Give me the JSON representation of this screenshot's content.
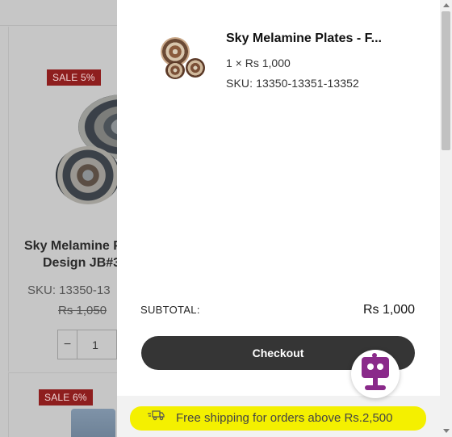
{
  "background_product": {
    "sale_badge_1": "SALE 5%",
    "sale_badge_2": "SALE 6%",
    "title_line_1": "Sky Melamine P",
    "title_line_2": "Design JB#3",
    "sku": "SKU: 13350-13",
    "old_price": "Rs 1,050",
    "quantity": "1",
    "minus_symbol": "−"
  },
  "cart": {
    "item": {
      "name": "Sky Melamine Plates - F...",
      "qty_price": "1 × Rs 1,000",
      "sku": "SKU: 13350-13351-13352",
      "image_icon": "plates-thumbnail"
    },
    "subtotal_label": "SUBTOTAL:",
    "subtotal_value": "Rs 1,000",
    "checkout_label": "Checkout",
    "shipping_message": "Free shipping for orders above Rs.2,500",
    "shipping_icon": "truck-icon",
    "chat_icon": "robot-chat-icon"
  },
  "colors": {
    "checkout_bg": "#353535",
    "highlight": "#f4f000",
    "sale_badge": "#8e1e1e",
    "chat_robot": "#8a2a8a"
  }
}
